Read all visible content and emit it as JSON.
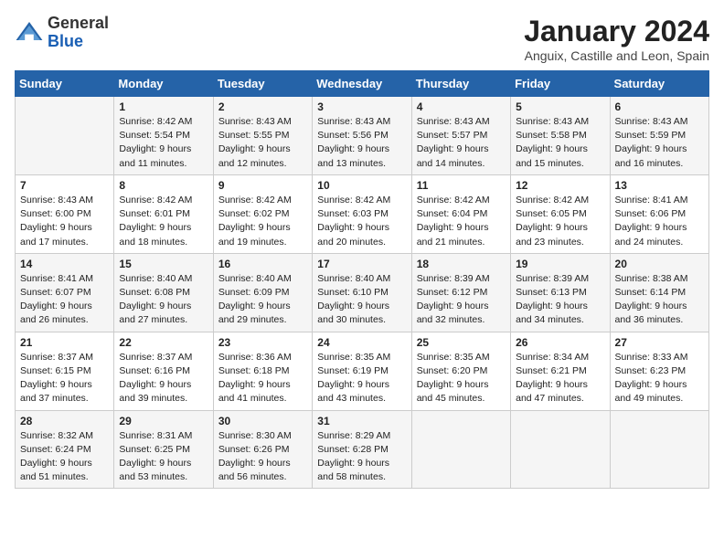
{
  "header": {
    "logo_general": "General",
    "logo_blue": "Blue",
    "month_title": "January 2024",
    "location": "Anguix, Castille and Leon, Spain"
  },
  "days_of_week": [
    "Sunday",
    "Monday",
    "Tuesday",
    "Wednesday",
    "Thursday",
    "Friday",
    "Saturday"
  ],
  "weeks": [
    [
      {
        "day": "",
        "sunrise": "",
        "sunset": "",
        "daylight": ""
      },
      {
        "day": "1",
        "sunrise": "Sunrise: 8:42 AM",
        "sunset": "Sunset: 5:54 PM",
        "daylight": "Daylight: 9 hours and 11 minutes."
      },
      {
        "day": "2",
        "sunrise": "Sunrise: 8:43 AM",
        "sunset": "Sunset: 5:55 PM",
        "daylight": "Daylight: 9 hours and 12 minutes."
      },
      {
        "day": "3",
        "sunrise": "Sunrise: 8:43 AM",
        "sunset": "Sunset: 5:56 PM",
        "daylight": "Daylight: 9 hours and 13 minutes."
      },
      {
        "day": "4",
        "sunrise": "Sunrise: 8:43 AM",
        "sunset": "Sunset: 5:57 PM",
        "daylight": "Daylight: 9 hours and 14 minutes."
      },
      {
        "day": "5",
        "sunrise": "Sunrise: 8:43 AM",
        "sunset": "Sunset: 5:58 PM",
        "daylight": "Daylight: 9 hours and 15 minutes."
      },
      {
        "day": "6",
        "sunrise": "Sunrise: 8:43 AM",
        "sunset": "Sunset: 5:59 PM",
        "daylight": "Daylight: 9 hours and 16 minutes."
      }
    ],
    [
      {
        "day": "7",
        "sunrise": "Sunrise: 8:43 AM",
        "sunset": "Sunset: 6:00 PM",
        "daylight": "Daylight: 9 hours and 17 minutes."
      },
      {
        "day": "8",
        "sunrise": "Sunrise: 8:42 AM",
        "sunset": "Sunset: 6:01 PM",
        "daylight": "Daylight: 9 hours and 18 minutes."
      },
      {
        "day": "9",
        "sunrise": "Sunrise: 8:42 AM",
        "sunset": "Sunset: 6:02 PM",
        "daylight": "Daylight: 9 hours and 19 minutes."
      },
      {
        "day": "10",
        "sunrise": "Sunrise: 8:42 AM",
        "sunset": "Sunset: 6:03 PM",
        "daylight": "Daylight: 9 hours and 20 minutes."
      },
      {
        "day": "11",
        "sunrise": "Sunrise: 8:42 AM",
        "sunset": "Sunset: 6:04 PM",
        "daylight": "Daylight: 9 hours and 21 minutes."
      },
      {
        "day": "12",
        "sunrise": "Sunrise: 8:42 AM",
        "sunset": "Sunset: 6:05 PM",
        "daylight": "Daylight: 9 hours and 23 minutes."
      },
      {
        "day": "13",
        "sunrise": "Sunrise: 8:41 AM",
        "sunset": "Sunset: 6:06 PM",
        "daylight": "Daylight: 9 hours and 24 minutes."
      }
    ],
    [
      {
        "day": "14",
        "sunrise": "Sunrise: 8:41 AM",
        "sunset": "Sunset: 6:07 PM",
        "daylight": "Daylight: 9 hours and 26 minutes."
      },
      {
        "day": "15",
        "sunrise": "Sunrise: 8:40 AM",
        "sunset": "Sunset: 6:08 PM",
        "daylight": "Daylight: 9 hours and 27 minutes."
      },
      {
        "day": "16",
        "sunrise": "Sunrise: 8:40 AM",
        "sunset": "Sunset: 6:09 PM",
        "daylight": "Daylight: 9 hours and 29 minutes."
      },
      {
        "day": "17",
        "sunrise": "Sunrise: 8:40 AM",
        "sunset": "Sunset: 6:10 PM",
        "daylight": "Daylight: 9 hours and 30 minutes."
      },
      {
        "day": "18",
        "sunrise": "Sunrise: 8:39 AM",
        "sunset": "Sunset: 6:12 PM",
        "daylight": "Daylight: 9 hours and 32 minutes."
      },
      {
        "day": "19",
        "sunrise": "Sunrise: 8:39 AM",
        "sunset": "Sunset: 6:13 PM",
        "daylight": "Daylight: 9 hours and 34 minutes."
      },
      {
        "day": "20",
        "sunrise": "Sunrise: 8:38 AM",
        "sunset": "Sunset: 6:14 PM",
        "daylight": "Daylight: 9 hours and 36 minutes."
      }
    ],
    [
      {
        "day": "21",
        "sunrise": "Sunrise: 8:37 AM",
        "sunset": "Sunset: 6:15 PM",
        "daylight": "Daylight: 9 hours and 37 minutes."
      },
      {
        "day": "22",
        "sunrise": "Sunrise: 8:37 AM",
        "sunset": "Sunset: 6:16 PM",
        "daylight": "Daylight: 9 hours and 39 minutes."
      },
      {
        "day": "23",
        "sunrise": "Sunrise: 8:36 AM",
        "sunset": "Sunset: 6:18 PM",
        "daylight": "Daylight: 9 hours and 41 minutes."
      },
      {
        "day": "24",
        "sunrise": "Sunrise: 8:35 AM",
        "sunset": "Sunset: 6:19 PM",
        "daylight": "Daylight: 9 hours and 43 minutes."
      },
      {
        "day": "25",
        "sunrise": "Sunrise: 8:35 AM",
        "sunset": "Sunset: 6:20 PM",
        "daylight": "Daylight: 9 hours and 45 minutes."
      },
      {
        "day": "26",
        "sunrise": "Sunrise: 8:34 AM",
        "sunset": "Sunset: 6:21 PM",
        "daylight": "Daylight: 9 hours and 47 minutes."
      },
      {
        "day": "27",
        "sunrise": "Sunrise: 8:33 AM",
        "sunset": "Sunset: 6:23 PM",
        "daylight": "Daylight: 9 hours and 49 minutes."
      }
    ],
    [
      {
        "day": "28",
        "sunrise": "Sunrise: 8:32 AM",
        "sunset": "Sunset: 6:24 PM",
        "daylight": "Daylight: 9 hours and 51 minutes."
      },
      {
        "day": "29",
        "sunrise": "Sunrise: 8:31 AM",
        "sunset": "Sunset: 6:25 PM",
        "daylight": "Daylight: 9 hours and 53 minutes."
      },
      {
        "day": "30",
        "sunrise": "Sunrise: 8:30 AM",
        "sunset": "Sunset: 6:26 PM",
        "daylight": "Daylight: 9 hours and 56 minutes."
      },
      {
        "day": "31",
        "sunrise": "Sunrise: 8:29 AM",
        "sunset": "Sunset: 6:28 PM",
        "daylight": "Daylight: 9 hours and 58 minutes."
      },
      {
        "day": "",
        "sunrise": "",
        "sunset": "",
        "daylight": ""
      },
      {
        "day": "",
        "sunrise": "",
        "sunset": "",
        "daylight": ""
      },
      {
        "day": "",
        "sunrise": "",
        "sunset": "",
        "daylight": ""
      }
    ]
  ]
}
